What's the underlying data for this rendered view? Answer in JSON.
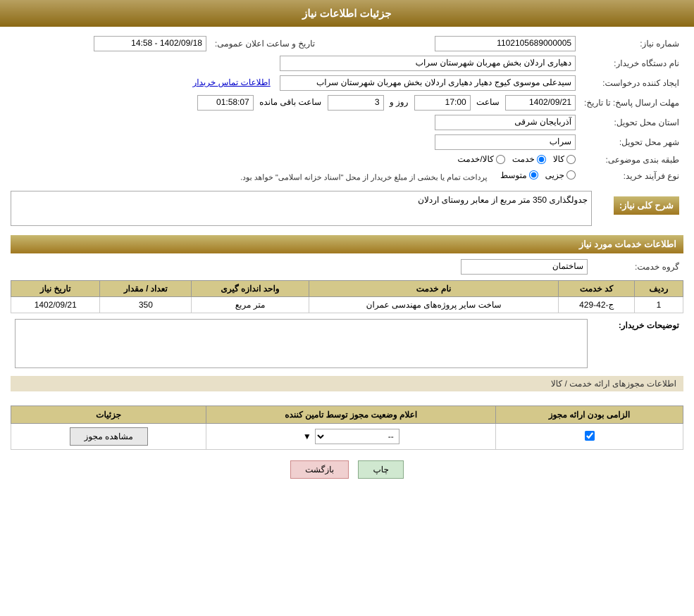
{
  "page": {
    "title": "جزئیات اطلاعات نیاز"
  },
  "header": {
    "need_number_label": "شماره نیاز:",
    "need_number_value": "1102105689000005",
    "date_label": "تاریخ و ساعت اعلان عمومی:",
    "date_value": "1402/09/18 - 14:58",
    "buyer_org_label": "نام دستگاه خریدار:",
    "buyer_org_value": "دهیاری اردلان بخش مهربان شهرستان سراب",
    "requester_label": "ایجاد کننده درخواست:",
    "requester_value": "سیدعلی موسوی کیوج دهیار دهیاری اردلان بخش مهربان شهرستان سراب",
    "contact_link": "اطلاعات تماس خریدار",
    "deadline_label": "مهلت ارسال پاسخ: تا تاریخ:",
    "deadline_date": "1402/09/21",
    "deadline_time_label": "ساعت",
    "deadline_time": "17:00",
    "deadline_days_label": "روز و",
    "deadline_days": "3",
    "deadline_remaining_label": "ساعت باقی مانده",
    "deadline_remaining": "01:58:07",
    "province_label": "استان محل تحویل:",
    "province_value": "آذربایجان شرقی",
    "city_label": "شهر محل تحویل:",
    "city_value": "سراب",
    "category_label": "طبقه بندی موضوعی:",
    "category_options": [
      "کالا",
      "خدمت",
      "کالا/خدمت"
    ],
    "category_selected": "خدمت",
    "purchase_type_label": "نوع فرآیند خرید:",
    "purchase_type_note": "پرداخت تمام یا بخشی از مبلغ خریدار از محل \"اسناد خزانه اسلامی\" خواهد بود.",
    "purchase_type_options": [
      "جزیی",
      "متوسط"
    ],
    "purchase_type_selected": "متوسط"
  },
  "description": {
    "section_title": "شرح کلی نیاز:",
    "value": "جدولگذاری 350 متر مربع از معابر روستای اردلان"
  },
  "services_section": {
    "title": "اطلاعات خدمات مورد نیاز",
    "service_group_label": "گروه خدمت:",
    "service_group_value": "ساختمان",
    "table": {
      "columns": [
        "ردیف",
        "کد خدمت",
        "نام خدمت",
        "واحد اندازه گیری",
        "تعداد / مقدار",
        "تاریخ نیاز"
      ],
      "rows": [
        {
          "row": "1",
          "code": "ج-42-429",
          "name": "ساخت سایر پروژه‌های مهندسی عمران",
          "unit": "متر مربع",
          "quantity": "350",
          "date": "1402/09/21"
        }
      ]
    }
  },
  "buyer_notes": {
    "label": "توضیحات خریدار:",
    "value": ""
  },
  "permissions_section": {
    "divider_text": "اطلاعات مجوزهای ارائه خدمت / کالا",
    "table": {
      "columns": [
        "الزامی بودن ارائه مجوز",
        "اعلام وضعیت مجوز توسط تامین کننده",
        "جزئیات"
      ],
      "rows": [
        {
          "required": true,
          "status": "--",
          "details_btn": "مشاهده مجوز"
        }
      ]
    }
  },
  "buttons": {
    "back": "بازگشت",
    "print": "چاپ"
  }
}
